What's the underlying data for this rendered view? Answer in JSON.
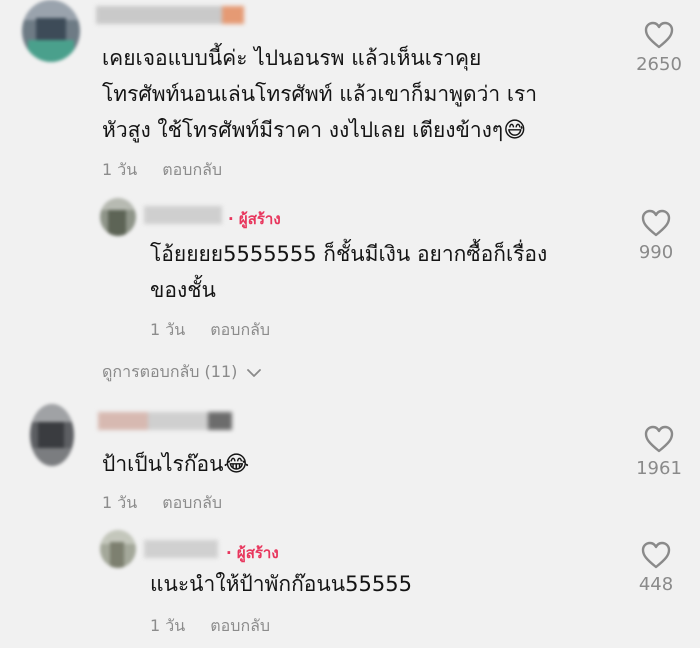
{
  "comments": [
    {
      "text_lines": [
        "เคยเจอแบบนี้ค่ะ ไปนอนรพ แล้วเห็นเราคุย",
        "โทรศัพท์นอนเล่นโทรศัพท์ แล้วเขาก็มาพูดว่า เรา",
        "หัวสูง ใช้โทรศัพท์มีราคา งงไปเลย เตียงข้างๆ"
      ],
      "emoji": "😅",
      "time": "1 วัน",
      "reply_label": "ตอบกลับ",
      "likes": "2650",
      "replies": [
        {
          "creator_label": "· ผู้สร้าง",
          "text_lines": [
            "โอ้ยยยย5555555 ก็ชั้นมีเงิน อยากซื้อก็เรื่อง",
            "ของชั้น"
          ],
          "time": "1 วัน",
          "reply_label": "ตอบกลับ",
          "likes": "990"
        }
      ],
      "view_replies_label": "ดูการตอบกลับ (11)"
    },
    {
      "text_lines": [
        "ป้าเป็นไรก๊อน"
      ],
      "emoji": "😂",
      "time": "1 วัน",
      "reply_label": "ตอบกลับ",
      "likes": "1961",
      "replies": [
        {
          "creator_label": "· ผู้สร้าง",
          "text_lines": [
            "แนะนำให้ป้าพักก๊อนน55555"
          ],
          "time": "1 วัน",
          "reply_label": "ตอบกลับ",
          "likes": "448"
        }
      ]
    }
  ],
  "colors": {
    "creator": "#e8365d",
    "meta": "#8c8c8c",
    "text": "#141414",
    "background": "#f1f1f1"
  },
  "icons": {
    "like": "heart-outline-icon",
    "expand": "chevron-down-icon"
  }
}
